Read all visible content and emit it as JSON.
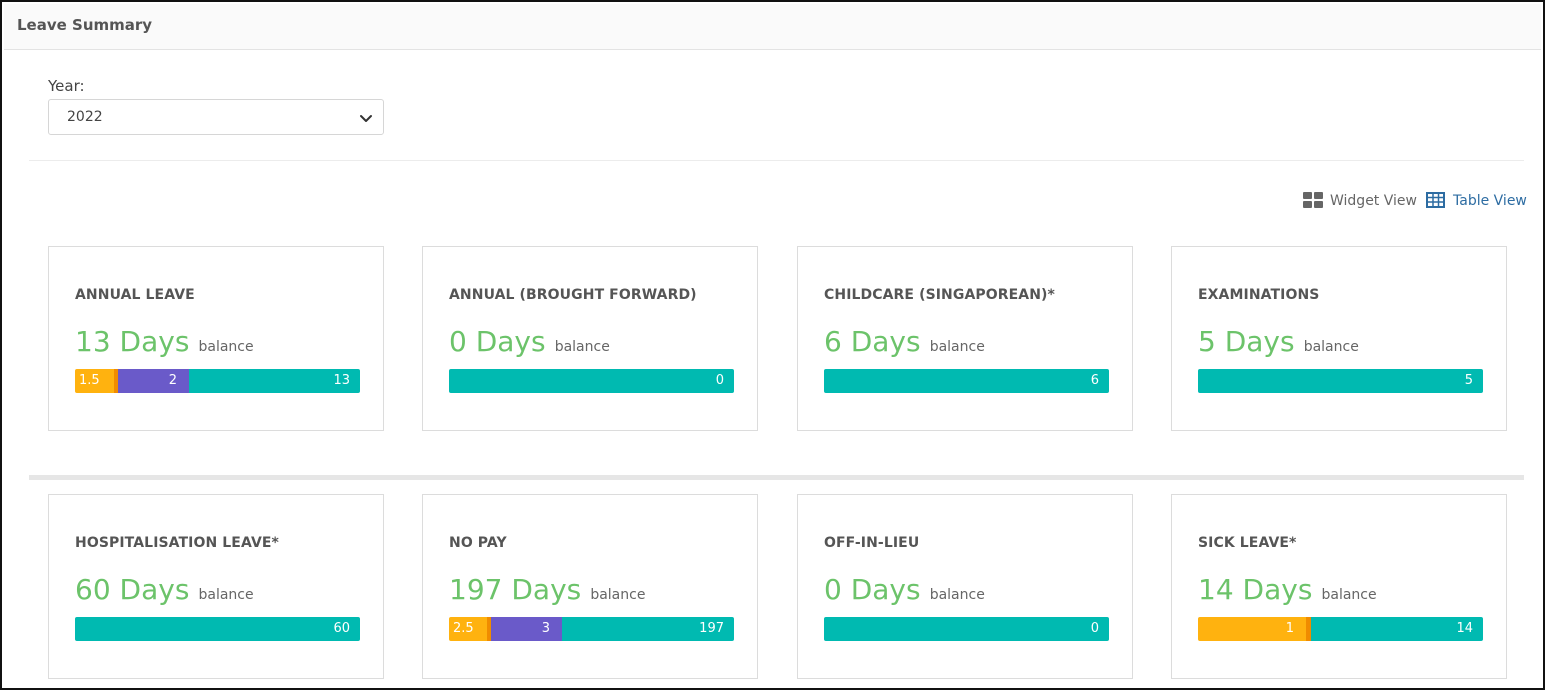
{
  "header": {
    "title": "Leave Summary"
  },
  "filter": {
    "year_label": "Year:",
    "year_value": "2022"
  },
  "view_toggle": {
    "widget_label": "Widget View",
    "table_label": "Table View"
  },
  "cards": [
    {
      "title": "ANNUAL LEAVE",
      "amount": "13 Days",
      "suffix": "balance",
      "segments": [
        {
          "label": "1.5",
          "color": "#ffb20f"
        },
        {
          "label": "",
          "color": "#f08c00"
        },
        {
          "label": "2",
          "color": "#6a5ac9"
        },
        {
          "label": "13",
          "color": "#00bab1"
        }
      ]
    },
    {
      "title": "ANNUAL (BROUGHT FORWARD)",
      "amount": "0 Days",
      "suffix": "balance",
      "segments": [
        {
          "label": "0",
          "color": "#00bab1"
        }
      ]
    },
    {
      "title": "CHILDCARE (SINGAPOREAN)*",
      "amount": "6 Days",
      "suffix": "balance",
      "segments": [
        {
          "label": "6",
          "color": "#00bab1"
        }
      ]
    },
    {
      "title": "EXAMINATIONS",
      "amount": "5 Days",
      "suffix": "balance",
      "segments": [
        {
          "label": "5",
          "color": "#00bab1"
        }
      ]
    },
    {
      "title": "HOSPITALISATION LEAVE*",
      "amount": "60 Days",
      "suffix": "balance",
      "segments": [
        {
          "label": "60",
          "color": "#00bab1"
        }
      ]
    },
    {
      "title": "NO PAY",
      "amount": "197 Days",
      "suffix": "balance",
      "segments": [
        {
          "label": "2.5",
          "color": "#ffb20f"
        },
        {
          "label": "",
          "color": "#f08c00"
        },
        {
          "label": "3",
          "color": "#6a5ac9"
        },
        {
          "label": "197",
          "color": "#00bab1"
        }
      ]
    },
    {
      "title": "OFF-IN-LIEU",
      "amount": "0 Days",
      "suffix": "balance",
      "segments": [
        {
          "label": "0",
          "color": "#00bab1"
        }
      ]
    },
    {
      "title": "SICK LEAVE*",
      "amount": "14 Days",
      "suffix": "balance",
      "segments": [
        {
          "label": "1",
          "color": "#ffb20f"
        },
        {
          "label": "",
          "color": "#f08c00"
        },
        {
          "label": "14",
          "color": "#00bab1"
        }
      ]
    }
  ]
}
